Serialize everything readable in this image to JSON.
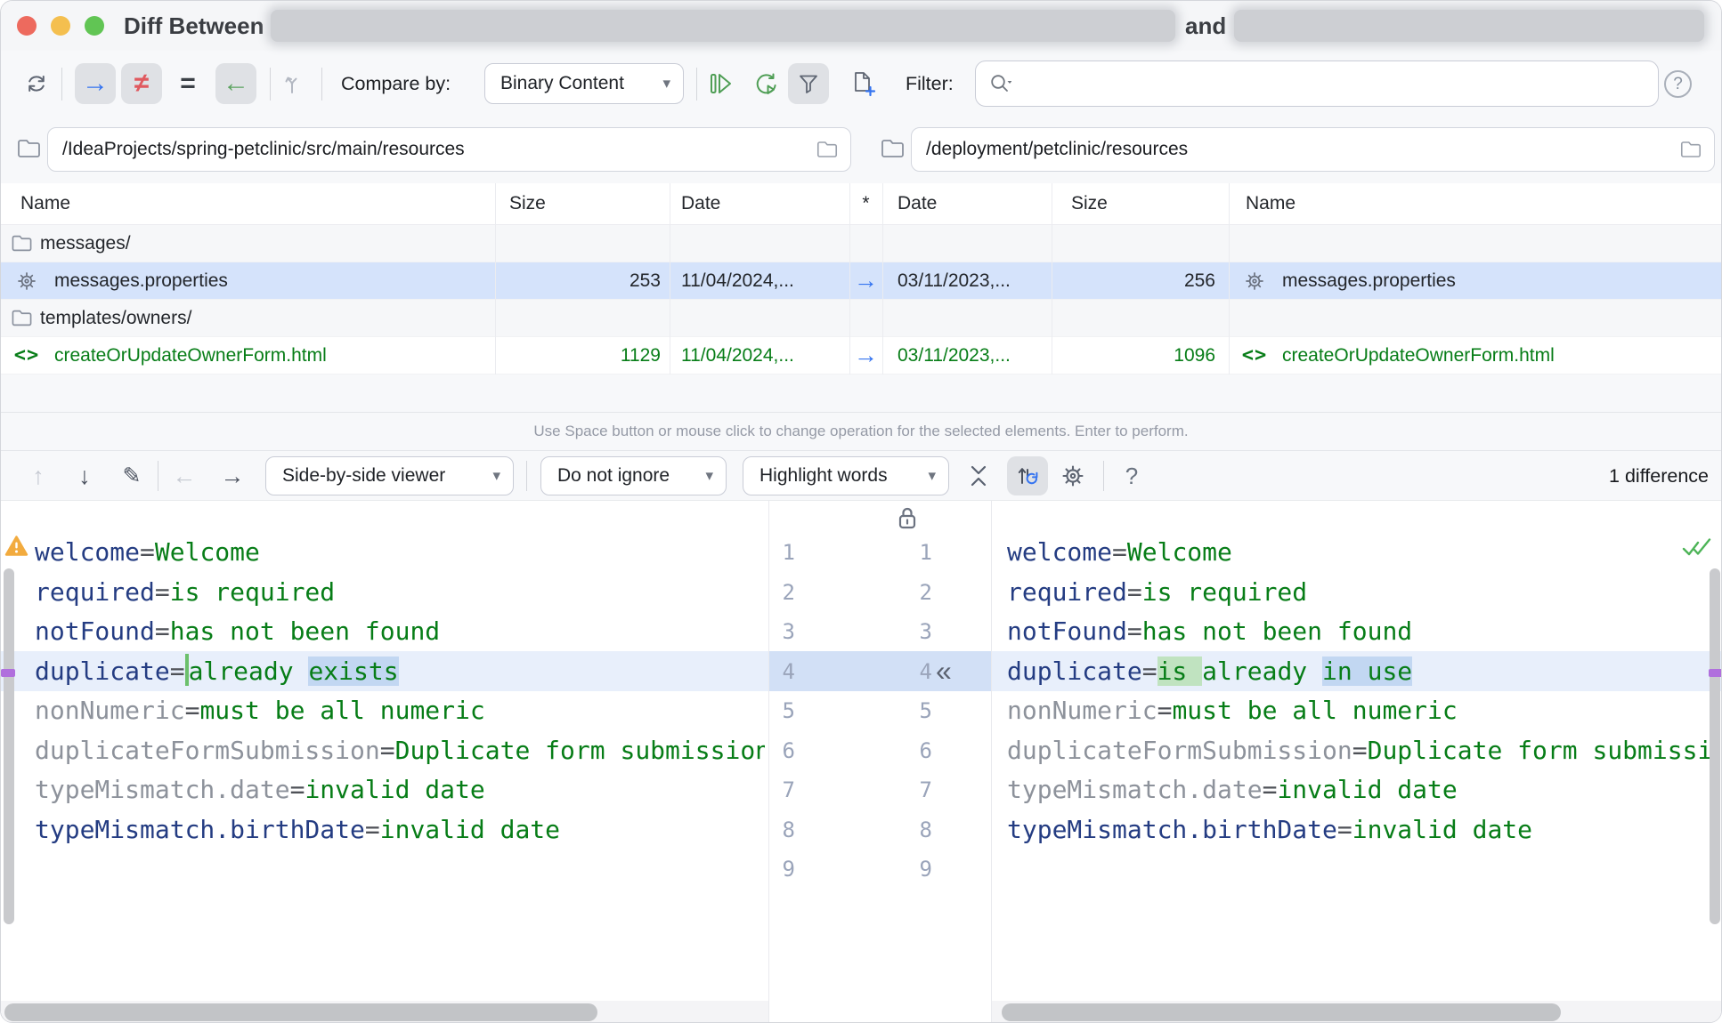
{
  "window": {
    "title_prefix": "Diff Between",
    "title_conjunction": "and"
  },
  "toolbar": {
    "compare_by_label": "Compare by:",
    "compare_by_value": "Binary Content",
    "filter_label": "Filter:",
    "search_value": ""
  },
  "paths": {
    "left": "/IdeaProjects/spring-petclinic/src/main/resources",
    "right": "/deployment/petclinic/resources"
  },
  "table": {
    "headers": {
      "name_left": "Name",
      "size_left": "Size",
      "date_left": "Date",
      "star": "*",
      "date_right": "Date",
      "size_right": "Size",
      "name_right": "Name"
    },
    "rows": [
      {
        "kind": "folder",
        "left_name": "messages/",
        "left_size": "",
        "left_date": "",
        "op": "",
        "right_date": "",
        "right_size": "",
        "right_name": ""
      },
      {
        "kind": "properties",
        "selected": true,
        "left_name": "messages.properties",
        "left_size": "253",
        "left_date": "11/04/2024,...",
        "op": "→",
        "right_date": "03/11/2023,...",
        "right_size": "256",
        "right_name": "messages.properties"
      },
      {
        "kind": "folder",
        "left_name": "templates/owners/",
        "left_size": "",
        "left_date": "",
        "op": "",
        "right_date": "",
        "right_size": "",
        "right_name": ""
      },
      {
        "kind": "html",
        "green": true,
        "left_name": "createOrUpdateOwnerForm.html",
        "left_size": "1129",
        "left_date": "11/04/2024,...",
        "op": "→",
        "right_date": "03/11/2023,...",
        "right_size": "1096",
        "right_name": "createOrUpdateOwnerForm.html"
      }
    ]
  },
  "hint": "Use Space button or mouse click to change operation for the selected elements. Enter to perform.",
  "diff_toolbar": {
    "viewer": "Side-by-side viewer",
    "ignore_policy": "Do not ignore",
    "highlight_mode": "Highlight words",
    "differences": "1 difference"
  },
  "editor": {
    "line_numbers": [
      "1",
      "2",
      "3",
      "4",
      "5",
      "6",
      "7",
      "8",
      "9"
    ],
    "lines": [
      {
        "n": "1",
        "left": [
          [
            "key",
            "welcome"
          ],
          [
            "eq",
            "="
          ],
          [
            "val",
            "Welcome"
          ]
        ],
        "right": [
          [
            "key",
            "welcome"
          ],
          [
            "eq",
            "="
          ],
          [
            "val",
            "Welcome"
          ]
        ]
      },
      {
        "n": "2",
        "left": [
          [
            "key",
            "required"
          ],
          [
            "eq",
            "="
          ],
          [
            "val",
            "is required"
          ]
        ],
        "right": [
          [
            "key",
            "required"
          ],
          [
            "eq",
            "="
          ],
          [
            "val",
            "is required"
          ]
        ]
      },
      {
        "n": "3",
        "left": [
          [
            "key",
            "notFound"
          ],
          [
            "eq",
            "="
          ],
          [
            "val",
            "has not been found"
          ]
        ],
        "right": [
          [
            "key",
            "notFound"
          ],
          [
            "eq",
            "="
          ],
          [
            "val",
            "has not been found"
          ]
        ]
      },
      {
        "n": "4",
        "changed": true,
        "left": [
          [
            "key",
            "duplicate"
          ],
          [
            "eq",
            "="
          ],
          [
            "ins",
            ""
          ],
          [
            "val",
            "already "
          ],
          [
            "chg",
            "exists"
          ]
        ],
        "right": [
          [
            "key",
            "duplicate"
          ],
          [
            "eq",
            "="
          ],
          [
            "add",
            "is "
          ],
          [
            "val",
            "already "
          ],
          [
            "chg",
            "in use"
          ]
        ]
      },
      {
        "n": "5",
        "left": [
          [
            "dim",
            "nonNumeric"
          ],
          [
            "eq",
            "="
          ],
          [
            "val",
            "must be all numeric"
          ]
        ],
        "right": [
          [
            "dim",
            "nonNumeric"
          ],
          [
            "eq",
            "="
          ],
          [
            "val",
            "must be all numeric"
          ]
        ]
      },
      {
        "n": "6",
        "left": [
          [
            "dim",
            "duplicateFormSubmission"
          ],
          [
            "eq",
            "="
          ],
          [
            "val",
            "Duplicate form submission is"
          ]
        ],
        "right": [
          [
            "dim",
            "duplicateFormSubmission"
          ],
          [
            "eq",
            "="
          ],
          [
            "val",
            "Duplicate form submission is"
          ]
        ]
      },
      {
        "n": "7",
        "left": [
          [
            "dim",
            "typeMismatch.date"
          ],
          [
            "eq",
            "="
          ],
          [
            "val",
            "invalid date"
          ]
        ],
        "right": [
          [
            "dim",
            "typeMismatch.date"
          ],
          [
            "eq",
            "="
          ],
          [
            "val",
            "invalid date"
          ]
        ]
      },
      {
        "n": "8",
        "left": [
          [
            "key",
            "typeMismatch.birthDate"
          ],
          [
            "eq",
            "="
          ],
          [
            "val",
            "invalid date"
          ]
        ],
        "right": [
          [
            "key",
            "typeMismatch.birthDate"
          ],
          [
            "eq",
            "="
          ],
          [
            "val",
            "invalid date"
          ]
        ]
      },
      {
        "n": "9",
        "left": [],
        "right": []
      }
    ]
  },
  "icons": {
    "apply_right": "→",
    "not_equal": "≠",
    "equal": "=",
    "apply_left": "←",
    "caret_down": "▾",
    "question": "?",
    "help": "?",
    "up": "↑",
    "down": "↓",
    "prev": "←",
    "next": "→",
    "pencil": "✎",
    "apply_chevron": "«",
    "op_arrow": "→",
    "code_glyph": "<>"
  },
  "colors": {
    "accent_blue": "#3574f0",
    "diff_red": "#e0595f",
    "diff_green": "#5ba35f",
    "value_green": "#077d17",
    "key_navy": "#243c82",
    "selection": "#d5e3fb",
    "changed_word": "#c2d7f2",
    "added_word": "#c0e3c0",
    "range_marker_purple": "#b06fdd"
  }
}
